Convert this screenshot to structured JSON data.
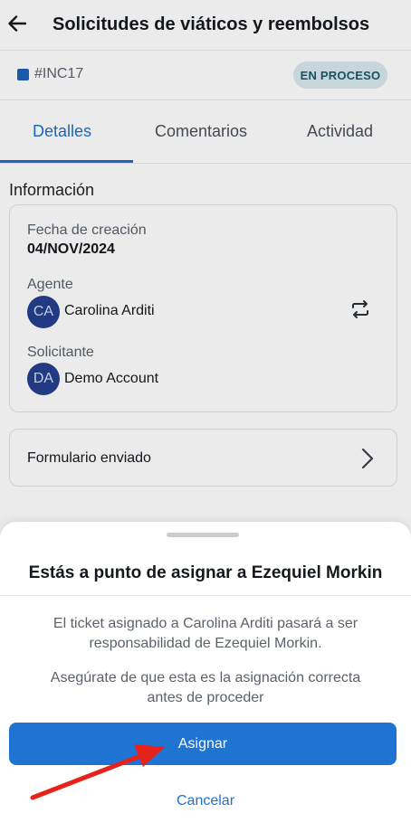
{
  "header": {
    "title": "Solicitudes de viáticos y reembolsos",
    "back_icon": "arrow-left-icon"
  },
  "ticket": {
    "id": "#INC17",
    "status": "EN PROCESO",
    "colors": {
      "square": "#1f62b8",
      "badge_bg": "#d8e9ee",
      "badge_text": "#195a6a"
    }
  },
  "tabs": [
    {
      "label": "Detalles",
      "active": true
    },
    {
      "label": "Comentarios",
      "active": false
    },
    {
      "label": "Actividad",
      "active": false
    }
  ],
  "info": {
    "section_title": "Información",
    "created_label": "Fecha de creación",
    "created_value": "04/NOV/2024",
    "agent_label": "Agente",
    "agent_initials": "CA",
    "agent_name": "Carolina Arditi",
    "requester_label": "Solicitante",
    "requester_initials": "DA",
    "requester_name": "Demo Account",
    "reassign_icon": "swap-arrows-icon"
  },
  "form": {
    "label": "Formulario enviado",
    "chevron_icon": "chevron-right-icon"
  },
  "sheet": {
    "title": "Estás a punto de asignar a Ezequiel Morkin",
    "message_line1": "El ticket asignado a Carolina Arditi pasará a ser",
    "message_line2": "responsabilidad de Ezequiel Morkin.",
    "confirm_line1": "Asegúrate de que esta es la asignación correcta",
    "confirm_line2": "antes de proceder",
    "assign_label": "Asignar",
    "cancel_label": "Cancelar"
  },
  "colors": {
    "accent": "#1f73d3",
    "annotation": "#e5231b"
  }
}
